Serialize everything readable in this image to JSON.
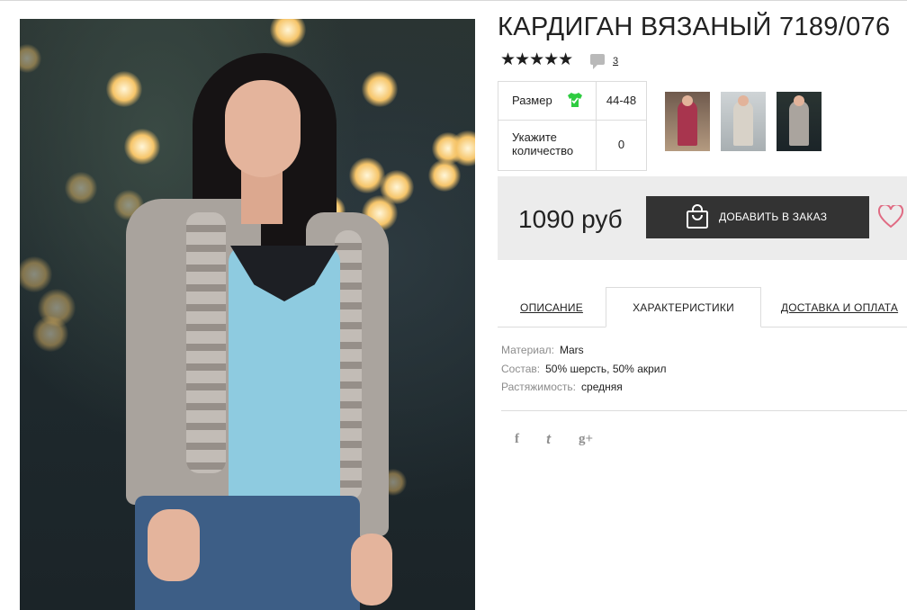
{
  "product": {
    "title": "КАРДИГАН ВЯЗАНЫЙ 7189/076",
    "rating_stars": "★★★★★",
    "rating": 5,
    "review_count": "3"
  },
  "options": {
    "size_label": "Размер",
    "size_value": "44-48",
    "quantity_label": "Укажите количество",
    "quantity_value": "0",
    "size_icon": "tshirt-icon"
  },
  "purchase": {
    "price": "1090 руб",
    "add_to_order_label": "ДОБАВИТЬ В ЗАКАЗ"
  },
  "tabs": [
    {
      "label": "ОПИСАНИЕ",
      "active": false
    },
    {
      "label": "ХАРАКТЕРИСТИКИ",
      "active": true
    },
    {
      "label": "ДОСТАВКА И ОПЛАТА",
      "active": false
    }
  ],
  "specs": [
    {
      "key": "Материал:",
      "value": "Mars"
    },
    {
      "key": "Состав:",
      "value": "50% шерсть, 50% акрил"
    },
    {
      "key": "Растяжимость:",
      "value": "средняя"
    }
  ],
  "social": {
    "facebook": "f",
    "twitter": "t",
    "google_plus": "g+"
  },
  "colors": {
    "button_bg": "#333333",
    "price_box_bg": "#ececec",
    "size_icon_green": "#2ecc40",
    "heart": "#e06b83"
  }
}
